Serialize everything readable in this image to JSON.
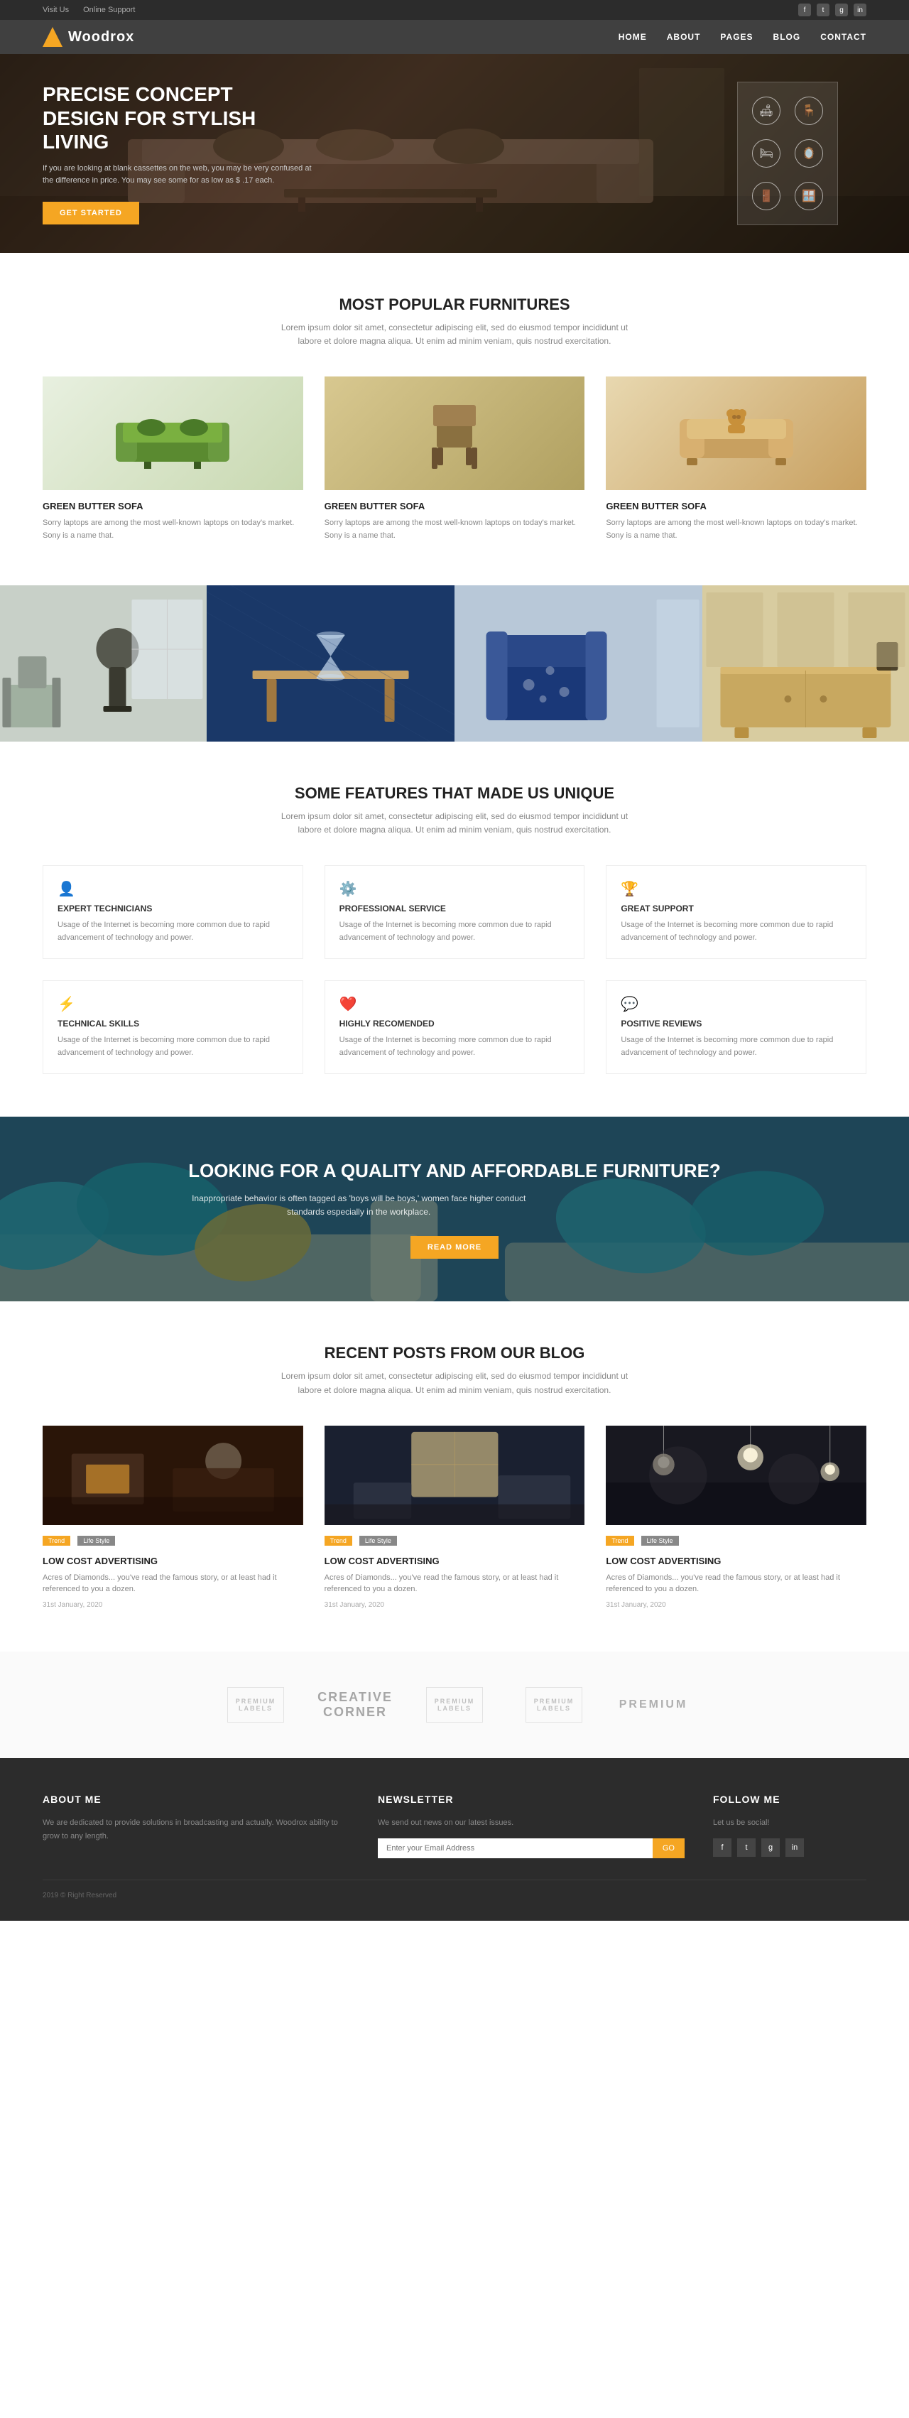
{
  "topbar": {
    "visit_us": "Visit Us",
    "online_support": "Online Support",
    "socials": [
      "f",
      "t",
      "g",
      "in"
    ]
  },
  "navbar": {
    "logo_text": "Woodrox",
    "links": [
      "HOME",
      "ABOUT",
      "PAGES",
      "BLOG",
      "CONTACT"
    ]
  },
  "hero": {
    "title": "PRECISE CONCEPT DESIGN FOR STYLISH LIVING",
    "subtitle": "If you are looking at blank cassettes on the web, you may be very confused at the difference in price. You may see some for as low as $ .17 each.",
    "cta_label": "Get Started",
    "icons": [
      {
        "symbol": "🛋"
      },
      {
        "symbol": "🪑"
      },
      {
        "symbol": "🛏"
      },
      {
        "symbol": "🪞"
      },
      {
        "symbol": "🚪"
      },
      {
        "symbol": "🪟"
      }
    ]
  },
  "furnitures_section": {
    "title": "MOST POPULAR FURNITURES",
    "subtitle": "Lorem ipsum dolor sit amet, consectetur adipiscing elit, sed do eiusmod tempor incididunt ut labore et dolore magna aliqua. Ut enim ad minim veniam, quis nostrud exercitation.",
    "items": [
      {
        "name": "GREEN BUTTER SOFA",
        "desc": "Sorry laptops are among the most well-known laptops on today's market. Sony is a name that.",
        "color": "#6a8c3a"
      },
      {
        "name": "GREEN BUTTER SOFA",
        "desc": "Sorry laptops are among the most well-known laptops on today's market. Sony is a name that.",
        "color": "#8a7040"
      },
      {
        "name": "GREEN BUTTER SOFA",
        "desc": "Sorry laptops are among the most well-known laptops on today's market. Sony is a name that.",
        "color": "#c09050"
      }
    ]
  },
  "features_section": {
    "title": "SOME FEATURES THAT MADE US UNIQUE",
    "subtitle": "Lorem ipsum dolor sit amet, consectetur adipiscing elit, sed do eiusmod tempor incididunt ut labore et dolore magna aliqua. Ut enim ad minim veniam, quis nostrud exercitation.",
    "items": [
      {
        "icon": "👤",
        "title": "EXPERT TECHNICIANS",
        "desc": "Usage of the Internet is becoming more common due to rapid advancement of technology and power."
      },
      {
        "icon": "⚙️",
        "title": "PROFESSIONAL SERVICE",
        "desc": "Usage of the Internet is becoming more common due to rapid advancement of technology and power."
      },
      {
        "icon": "🏆",
        "title": "GREAT SUPPORT",
        "desc": "Usage of the Internet is becoming more common due to rapid advancement of technology and power."
      },
      {
        "icon": "⚡",
        "title": "TECHNICAL SKILLS",
        "desc": "Usage of the Internet is becoming more common due to rapid advancement of technology and power."
      },
      {
        "icon": "❤️",
        "title": "HIGHLY RECOMENDED",
        "desc": "Usage of the Internet is becoming more common due to rapid advancement of technology and power."
      },
      {
        "icon": "💬",
        "title": "POSITIVE REVIEWS",
        "desc": "Usage of the Internet is becoming more common due to rapid advancement of technology and power."
      }
    ]
  },
  "cta_section": {
    "title": "LOOKING FOR A QUALITY AND AFFORDABLE FURNITURE?",
    "subtitle": "Inappropriate behavior is often tagged as 'boys will be boys,' women face higher conduct standards especially in the workplace.",
    "button_label": "READ MORE"
  },
  "blog_section": {
    "title": "RECENT POSTS FROM OUR BLOG",
    "subtitle": "Lorem ipsum dolor sit amet, consectetur adipiscing elit, sed do eiusmod tempor incididunt ut labore et dolore magna aliqua. Ut enim ad minim veniam, quis nostrud exercitation.",
    "posts": [
      {
        "badge1": "Trend",
        "badge2": "Life Style",
        "title": "LOW COST ADVERTISING",
        "excerpt": "Acres of Diamonds... you've read the famous story, or at least had it referenced to you a dozen.",
        "date": "31st January, 2020"
      },
      {
        "badge1": "Trend",
        "badge2": "Life Style",
        "title": "LOW COST ADVERTISING",
        "excerpt": "Acres of Diamonds... you've read the famous story, or at least had it referenced to you a dozen.",
        "date": "31st January, 2020"
      },
      {
        "badge1": "Trend",
        "badge2": "Life Style",
        "title": "LOW COST ADVERTISING",
        "excerpt": "Acres of Diamonds... you've read the famous story, or at least had it referenced to you a dozen.",
        "date": "31st January, 2020"
      }
    ]
  },
  "partners": {
    "logos": [
      "PREMIUM LABELS",
      "CREATIVE CORNER",
      "premium labels",
      "PREMIUM LABELS",
      "PREMIUM"
    ]
  },
  "footer": {
    "about_title": "ABOUT ME",
    "about_text": "We are dedicated to provide solutions in broadcasting and actually. Woodrox ability to grow to any length.",
    "newsletter_title": "NEWSLETTER",
    "newsletter_placeholder": "Enter your Email Address",
    "newsletter_btn": "GO",
    "follow_title": "FOLLOW ME",
    "follow_text": "Let us be social!",
    "social_icons": [
      "f",
      "t",
      "g",
      "in"
    ],
    "copyright": "2019 © Right Reserved"
  }
}
